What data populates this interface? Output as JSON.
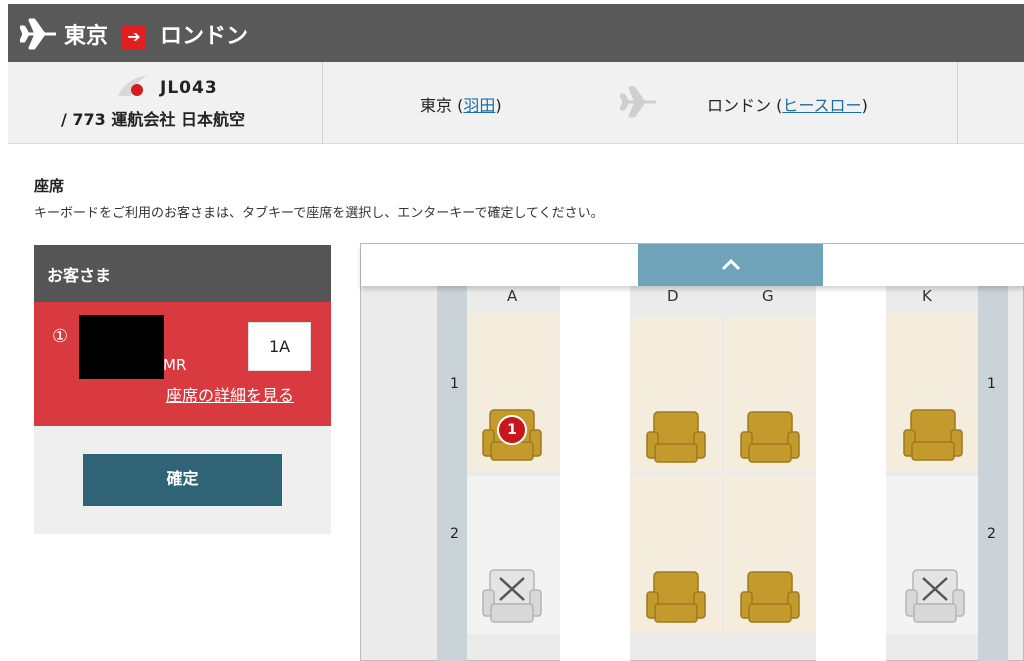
{
  "header": {
    "origin": "東京",
    "arrow": "➔",
    "destination": "ロンドン"
  },
  "flight": {
    "number": "JL043",
    "aircraft_operator": "/ 773 運航会社 日本航空",
    "origin_city": "東京",
    "origin_airport": "羽田",
    "dest_city": "ロンドン",
    "dest_airport": "ヒースロー",
    "paren_open": "(",
    "paren_close": ")"
  },
  "seat_section": {
    "title": "座席",
    "description": "キーボードをご利用のお客さまは、タブキーで座席を選択し、エンターキーで確定してください。"
  },
  "passenger_panel": {
    "header": "お客さま",
    "number": "①",
    "title": "MR",
    "seat": "1A",
    "detail_link": "座席の詳細を見る",
    "confirm_label": "確定"
  },
  "seat_map": {
    "scroll_up_icon": "chevron-up-icon",
    "columns": [
      "A",
      "D",
      "G",
      "K"
    ],
    "rows": [
      "1",
      "2"
    ],
    "selected_badge": "1",
    "seats": [
      {
        "row": "1",
        "col": "A",
        "status": "selected"
      },
      {
        "row": "1",
        "col": "D",
        "status": "available"
      },
      {
        "row": "1",
        "col": "G",
        "status": "available"
      },
      {
        "row": "1",
        "col": "K",
        "status": "available"
      },
      {
        "row": "2",
        "col": "A",
        "status": "unavailable"
      },
      {
        "row": "2",
        "col": "D",
        "status": "available"
      },
      {
        "row": "2",
        "col": "G",
        "status": "available"
      },
      {
        "row": "2",
        "col": "K",
        "status": "unavailable"
      }
    ]
  },
  "colors": {
    "topbar": "#595959",
    "accent_red": "#d83a3f",
    "confirm_button": "#2e6476",
    "seat_gold": "#c49a2c",
    "scroll_button": "#6fa3ba"
  }
}
